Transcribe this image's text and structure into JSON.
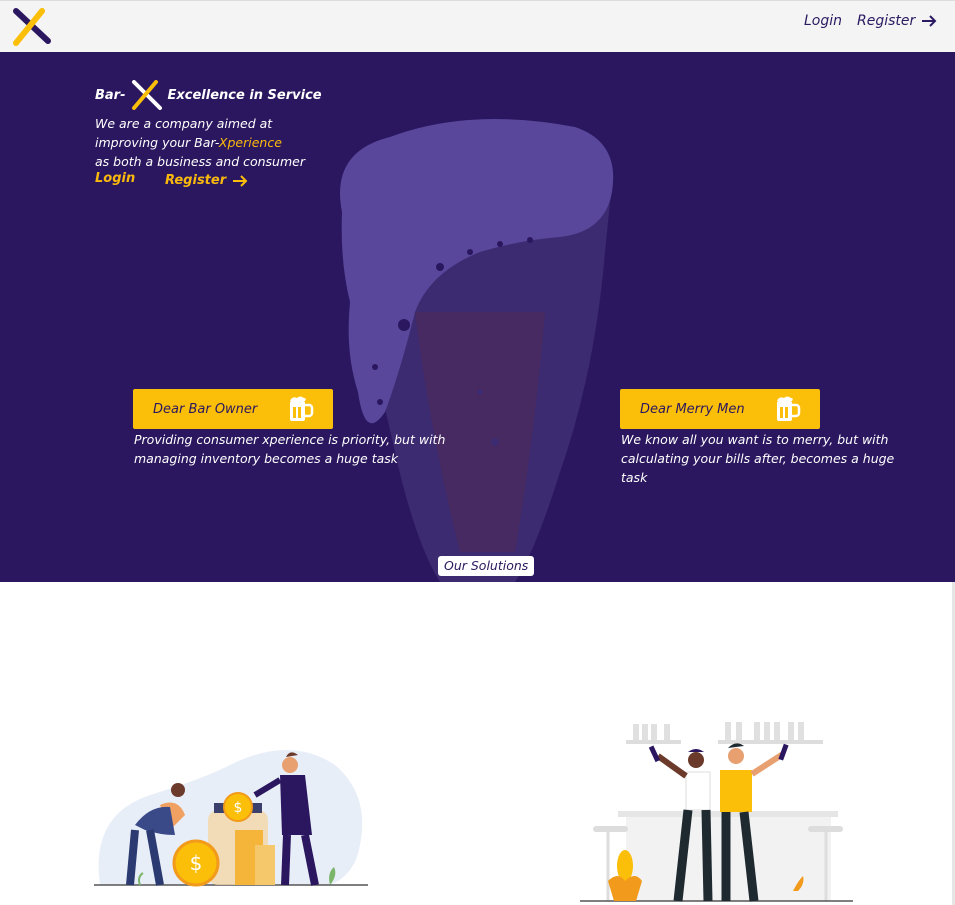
{
  "nav": {
    "login_label": "Login",
    "register_label": "Register"
  },
  "hero": {
    "brand_prefix": "Bar-",
    "brand_suffix": "Excellence in Service",
    "tagline_line1": "We are a company aimed at",
    "tagline_line2_prefix": "improving your Bar-",
    "tagline_line2_accent": "Xperience",
    "tagline_line3": "as both a business and consumer",
    "login_label": "Login",
    "register_label": "Register"
  },
  "cards": {
    "owner": {
      "button_label": "Dear Bar Owner",
      "text": "Providing consumer xperience is priority, but with managing inventory becomes a huge task"
    },
    "merry": {
      "button_label": "Dear Merry Men",
      "text": "We know all you want is to merry, but with calculating your bills after, becomes a huge task"
    }
  },
  "solutions_label": "Our Solutions",
  "colors": {
    "primary": "#2b175f",
    "accent": "#fbbf09",
    "topbar": "#f4f4f4"
  },
  "icons": [
    "logo-x-icon",
    "arrow-right-icon",
    "beer-mug-icon"
  ]
}
